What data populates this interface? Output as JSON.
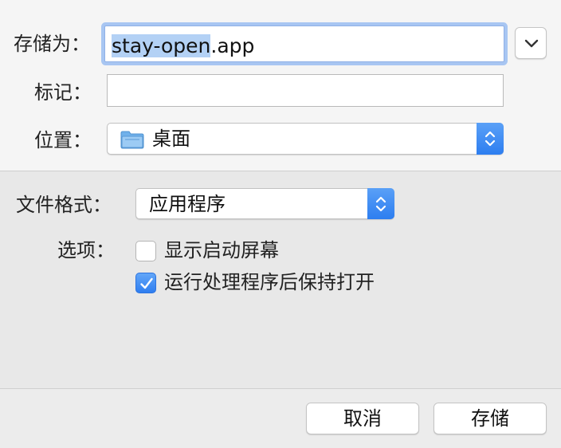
{
  "save_as": {
    "label": "存储为：",
    "filename_selected": "stay-open",
    "filename_rest": ".app"
  },
  "tags": {
    "label": "标记：",
    "value": ""
  },
  "location": {
    "label": "位置：",
    "value": "桌面",
    "icon": "folder-icon"
  },
  "format": {
    "label": "文件格式：",
    "value": "应用程序"
  },
  "options": {
    "label": "选项：",
    "items": [
      {
        "label": "显示启动屏幕",
        "checked": false
      },
      {
        "label": "运行处理程序后保持打开",
        "checked": true
      }
    ]
  },
  "buttons": {
    "cancel": "取消",
    "save": "存储"
  },
  "colors": {
    "accent": "#3478f6",
    "focus_ring": "#a8c6f2",
    "selection": "#b3d1f5"
  }
}
